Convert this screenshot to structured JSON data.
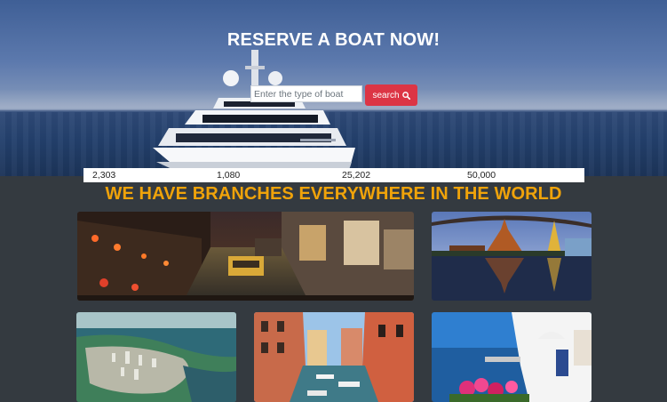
{
  "hero": {
    "title": "RESERVE A BOAT NOW!",
    "search": {
      "placeholder": "Enter the type of boat",
      "value": ""
    },
    "search_button_label": "search",
    "search_icon": "search-icon"
  },
  "stats": [
    "2,303",
    "1,080",
    "25,202",
    "50,000"
  ],
  "branches": {
    "title": "WE HAVE BRANCHES EVERYWHERE IN THE WORLD"
  },
  "colors": {
    "background": "#343a40",
    "accent_title": "#f0a30a",
    "button": "#dc3545"
  }
}
